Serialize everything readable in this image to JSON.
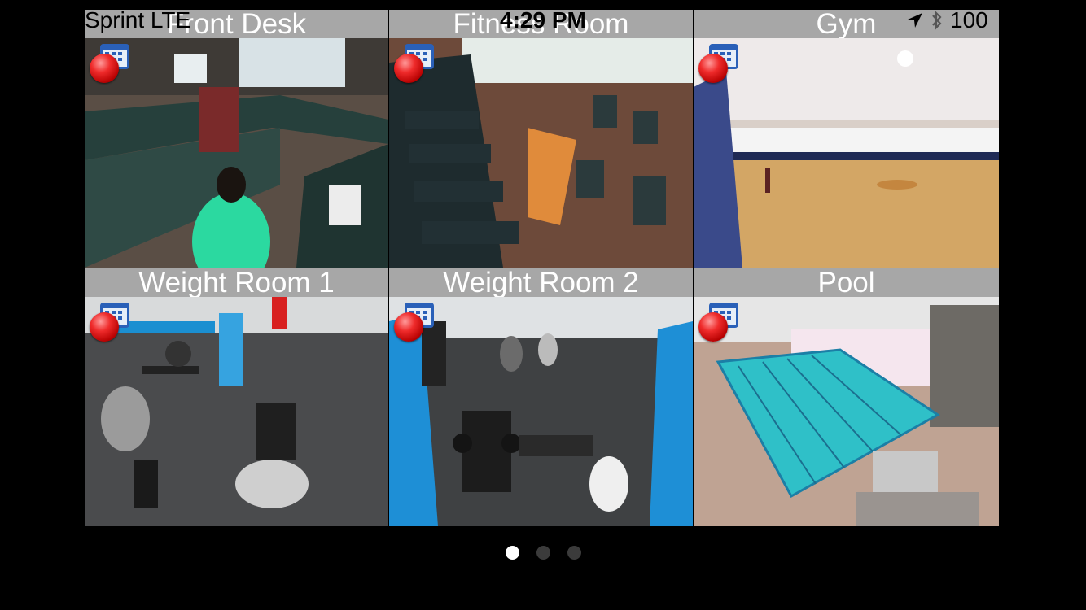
{
  "status_bar": {
    "carrier": "Sprint  LTE",
    "time": "4:29 PM",
    "battery": "100"
  },
  "cameras": [
    {
      "name": "Front Desk",
      "recording": true
    },
    {
      "name": "Fitness Room",
      "recording": true
    },
    {
      "name": "Gym",
      "recording": true
    },
    {
      "name": "Weight Room 1",
      "recording": true
    },
    {
      "name": "Weight Room 2",
      "recording": true
    },
    {
      "name": "Pool",
      "recording": true
    }
  ],
  "pager": {
    "pages": 3,
    "current": 1
  },
  "icons": {
    "schedule": "calendar-icon",
    "recording": "record-indicator-icon",
    "location": "location-arrow-icon",
    "bluetooth": "bluetooth-icon"
  },
  "colors": {
    "background": "#000000",
    "header_bar": "#a7a7a7",
    "record_red": "#e01f1f",
    "pager_active": "#ffffff",
    "pager_inactive": "#3b3b3b"
  }
}
